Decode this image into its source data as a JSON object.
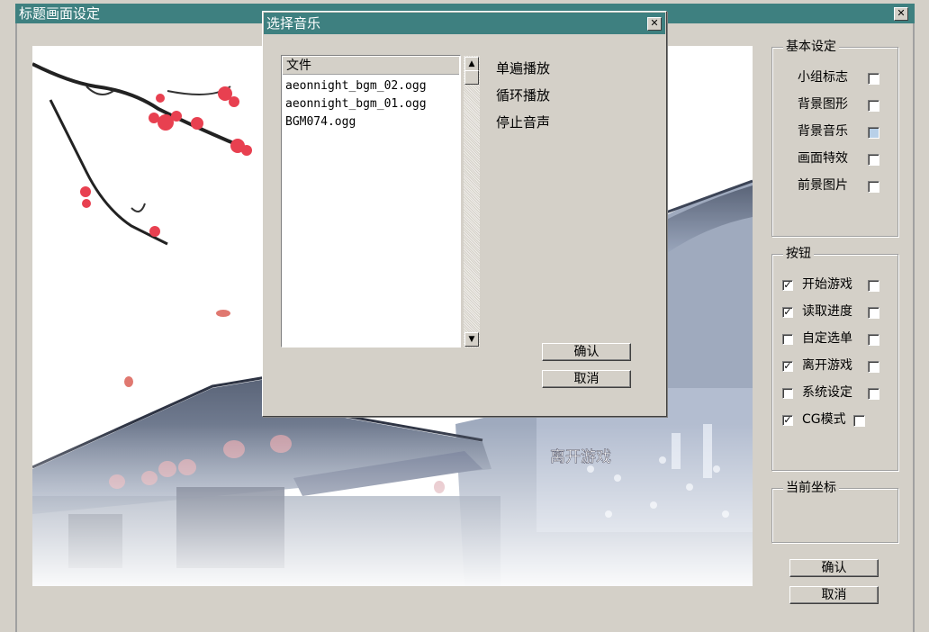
{
  "main_window": {
    "title": "标题画面设定",
    "close_glyph": "✕"
  },
  "basic_settings": {
    "label": "基本设定",
    "items": [
      {
        "label": "小组标志",
        "checked": false
      },
      {
        "label": "背景图形",
        "checked": false
      },
      {
        "label": "背景音乐",
        "checked": false,
        "highlighted": true
      },
      {
        "label": "画面特效",
        "checked": false
      },
      {
        "label": "前景图片",
        "checked": false
      }
    ]
  },
  "buttons_group": {
    "label": "按钮",
    "items": [
      {
        "label": "开始游戏",
        "checked": true,
        "mark": "✓"
      },
      {
        "label": "读取进度",
        "checked": true,
        "mark": "✓"
      },
      {
        "label": "自定选单",
        "checked": false,
        "mark": ""
      },
      {
        "label": "离开游戏",
        "checked": true,
        "mark": "✓"
      },
      {
        "label": "系统设定",
        "checked": false,
        "mark": ""
      },
      {
        "label": "CG模式",
        "checked": true,
        "mark": "✓"
      }
    ]
  },
  "coords_group": {
    "label": "当前坐标"
  },
  "footer": {
    "confirm": "确认",
    "cancel": "取消"
  },
  "preview": {
    "overlay_text": "离开游戏"
  },
  "dialog": {
    "title": "选择音乐",
    "close_glyph": "✕",
    "list_header": "文件",
    "files": [
      "aeonnight_bgm_02.ogg",
      "aeonnight_bgm_01.ogg",
      "BGM074.ogg"
    ],
    "play_options": [
      "单遍播放",
      "循环播放",
      "停止音声"
    ],
    "confirm": "确认",
    "cancel": "取消",
    "scroll_up": "▲",
    "scroll_down": "▼"
  },
  "colors": {
    "titlebar": "#3e8080",
    "face": "#d4d0c8",
    "highlight_checkbox": "#b8d0e8"
  }
}
